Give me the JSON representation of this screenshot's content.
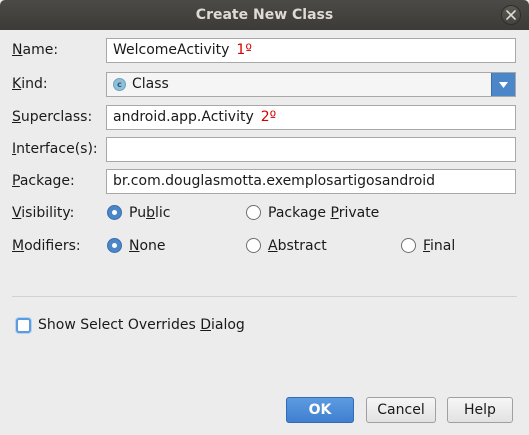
{
  "window": {
    "title": "Create New Class"
  },
  "form": {
    "name": {
      "label": "Name:",
      "label_mnemonic": "N",
      "label_rest": "ame:",
      "value": "WelcomeActivity",
      "annotation": "1º"
    },
    "kind": {
      "label_mnemonic": "K",
      "label_rest": "ind:",
      "value": "Class",
      "icon_letter": "c",
      "icon": "class-icon"
    },
    "superclass": {
      "label_mnemonic": "S",
      "label_rest": "uperclass:",
      "value": "android.app.Activity",
      "annotation": "2º"
    },
    "interfaces": {
      "label_mnemonic": "I",
      "label_rest": "nterface(s):",
      "value": ""
    },
    "package": {
      "label_mnemonic": "P",
      "label_rest": "ackage:",
      "value": "br.com.douglasmotta.exemplosartigosandroid"
    },
    "visibility": {
      "label_mnemonic": "V",
      "label_rest": "isibility:",
      "options": [
        {
          "pre": "Pu",
          "mn": "b",
          "post": "lic",
          "selected": true
        },
        {
          "pre": "Package ",
          "mn": "P",
          "post": "rivate",
          "selected": false
        }
      ]
    },
    "modifiers": {
      "label_mnemonic": "M",
      "label_rest": "odifiers:",
      "options": [
        {
          "pre": "",
          "mn": "N",
          "post": "one",
          "selected": true
        },
        {
          "pre": "",
          "mn": "A",
          "post": "bstract",
          "selected": false
        },
        {
          "pre": "",
          "mn": "F",
          "post": "inal",
          "selected": false
        }
      ]
    },
    "show_overrides": {
      "pre": "Show Select Overrides ",
      "mn": "D",
      "post": "ialog",
      "checked": false
    }
  },
  "buttons": {
    "ok": "OK",
    "cancel": "Cancel",
    "help": "Help"
  },
  "colors": {
    "accent": "#4a86c8",
    "annotation": "#d40000",
    "titlebar": "#3c3b37"
  }
}
